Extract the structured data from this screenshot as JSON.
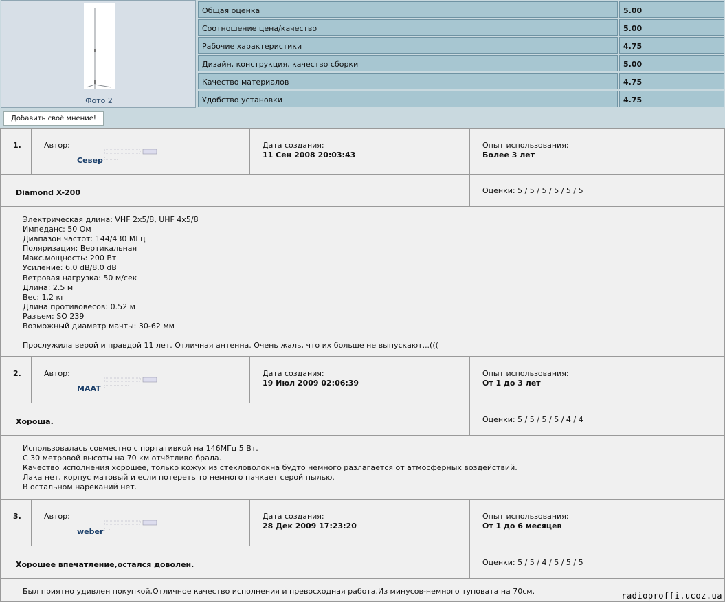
{
  "photo": {
    "caption": "Фото 2"
  },
  "ratings": [
    {
      "label": "Общая оценка",
      "value": "5.00"
    },
    {
      "label": "Соотношение цена/качество",
      "value": "5.00"
    },
    {
      "label": "Рабочие характеристики",
      "value": "4.75"
    },
    {
      "label": "Дизайн, конструкция, качество сборки",
      "value": "5.00"
    },
    {
      "label": "Качество материалов",
      "value": "4.75"
    },
    {
      "label": "Удобство установки",
      "value": "4.75"
    }
  ],
  "add_opinion_label": "Добавить своё мнение!",
  "labels": {
    "author": "Автор:",
    "created": "Дата создания:",
    "experience": "Опыт использования:"
  },
  "reviews": [
    {
      "number": "1.",
      "author": "Север",
      "date": "11 Сен 2008 20:03:43",
      "experience": "Более 3 лет",
      "title": "Diamond X-200",
      "scores": "Оценки: 5 / 5 / 5 / 5 / 5 / 5",
      "body": "Электрическая длина: VHF 2x5/8, UHF 4x5/8\nИмпеданс: 50 Ом\nДиапазон частот: 144/430 МГц\nПоляризация: Вертикальная\nМакс.мощность: 200 Вт\nУсиление: 6.0 dB/8.0 dB\nВетровая нагрузка: 50 м/сек\nДлина: 2.5 м\nВес: 1.2 кг\nДлина противовесов: 0.52 м\nРазъем: SO 239\nВозможный диаметр мачты: 30-62 мм\n\nПрослужила верой и правдой 11 лет. Отличная антенна. Очень жаль, что их больше не выпускают...((("
    },
    {
      "number": "2.",
      "author": "MAAT",
      "date": "19 Июл 2009 02:06:39",
      "experience": "От 1 до 3 лет",
      "title": "Хороша.",
      "scores": "Оценки: 5 / 5 / 5 / 5 / 4 / 4",
      "body": "Использовалась совместно с портативкой на 146МГц 5 Вт.\nС 30 метровой высоты на 70 км отчётливо брала.\nКачество исполнения хорошее, только кожух из стекловолокна будто немного разлагается от атмосферных воздействий.\nЛака нет, корпус матовый и если потереть то немного пачкает серой пылью.\nВ остальном нареканий нет."
    },
    {
      "number": "3.",
      "author": "weber",
      "date": "28 Дек 2009 17:23:20",
      "experience": "От 1 до 6 месяцев",
      "title": "Хорошее впечатление,остался доволен.",
      "scores": "Оценки: 5 / 5 / 4 / 5 / 5 / 5",
      "body": "Был приятно удивлен покупкой.Отличное качество исполнения и превосходная работа.Из минусов-немного туповата на 70см."
    }
  ],
  "watermark": "radioproffi.ucoz.ua"
}
